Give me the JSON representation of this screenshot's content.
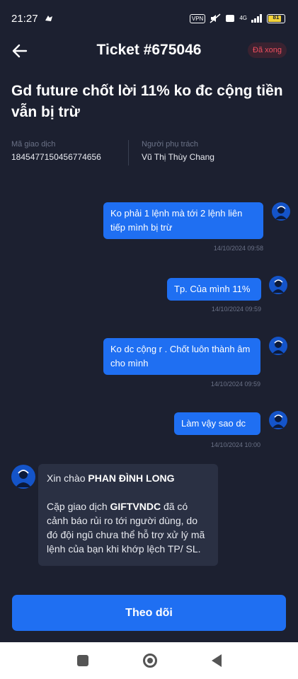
{
  "status_bar": {
    "time": "21:27",
    "vpn_label": "VPN",
    "network_label": "4G",
    "battery_level": "81",
    "battery_fraction": 0.81
  },
  "header": {
    "back_icon": "arrow-left-icon",
    "title": "Ticket #675046",
    "status": "Đã xong"
  },
  "ticket": {
    "subject": "Gd future chốt lời 11% ko đc cộng tiền vẫn bị trừ",
    "meta": [
      {
        "label": "Mã giao dịch",
        "value": "1845477150456774656"
      },
      {
        "label": "Người phụ trách",
        "value": "Vũ Thị Thùy Chang"
      }
    ]
  },
  "messages": [
    {
      "direction": "out",
      "text": "Ko phải 1 lệnh mà tới 2 lệnh liên tiếp mình bị trừ",
      "time": "14/10/2024 09:58"
    },
    {
      "direction": "out",
      "text": "Tp. Của mình 11%",
      "time": "14/10/2024 09:59"
    },
    {
      "direction": "out",
      "text": "Ko dc cộng r . Chốt luôn thành âm cho mình",
      "time": "14/10/2024 09:59"
    },
    {
      "direction": "out",
      "text": "Làm vậy sao dc",
      "time": "14/10/2024 10:00"
    }
  ],
  "incoming": {
    "greeting": "Xin chào",
    "name": "PHAN ĐÌNH LONG",
    "body_prefix": "Cặp giao dịch",
    "pair": "GIFTVNDC",
    "body_suffix": "đã có cảnh báo rủi ro tới người dùng, do đó đội ngũ chưa thể hỗ trợ xử lý mã lệnh của bạn khi khớp lệch TP/ SL."
  },
  "actions": {
    "follow_label": "Theo dõi"
  },
  "colors": {
    "background": "#1c2030",
    "accent": "#1f6ff2",
    "incoming_bubble": "#2a3043",
    "status_done": "#ef4f5f"
  }
}
